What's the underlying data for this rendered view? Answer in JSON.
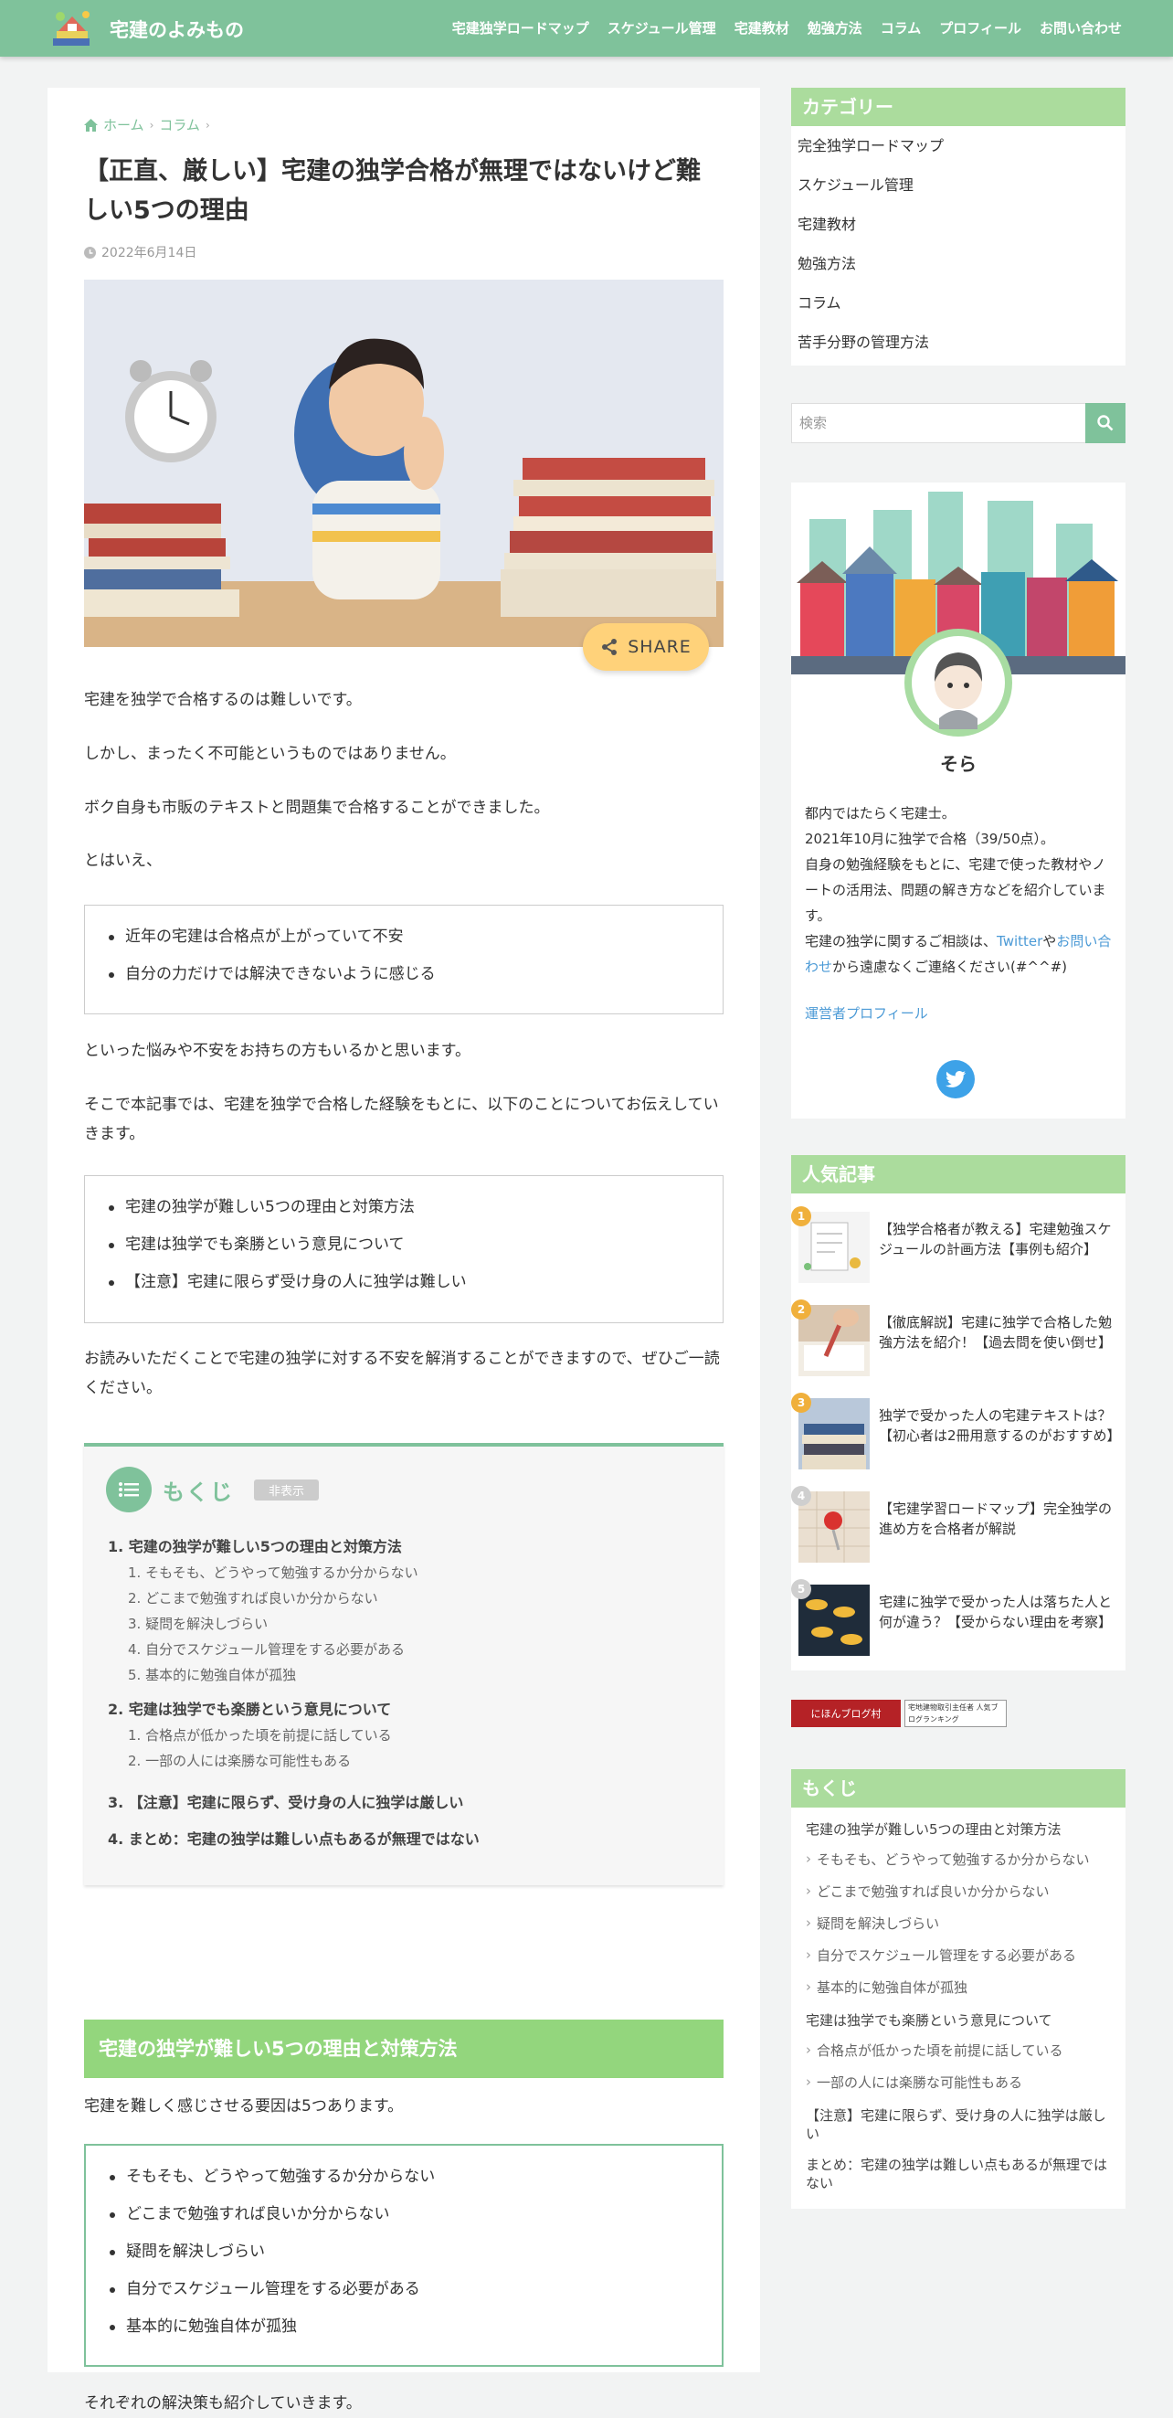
{
  "header": {
    "site_title": "宅建のよみもの",
    "nav": [
      "宅建独学ロードマップ",
      "スケジュール管理",
      "宅建教材",
      "勉強方法",
      "コラム",
      "プロフィール",
      "お問い合わせ"
    ]
  },
  "breadcrumb": {
    "home": "ホーム",
    "category": "コラム"
  },
  "article": {
    "title": "【正直、厳しい】宅建の独学合格が無理ではないけど難しい5つの理由",
    "date": "2022年6月14日",
    "share": "SHARE",
    "p1": "宅建を独学で合格するのは難しいです。",
    "p2": "しかし、まったく不可能というものではありません。",
    "p3": "ボク自身も市販のテキストと問題集で合格することができました。",
    "p4": "とはいえ、",
    "box1": [
      "近年の宅建は合格点が上がっていて不安",
      "自分の力だけでは解決できないように感じる"
    ],
    "p5": "といった悩みや不安をお持ちの方もいるかと思います。",
    "p6": "そこで本記事では、宅建を独学で合格した経験をもとに、以下のことについてお伝えしていきます。",
    "box2": [
      "宅建の独学が難しい5つの理由と対策方法",
      "宅建は独学でも楽勝という意見について",
      "【注意】宅建に限らず受け身の人に独学は難しい"
    ],
    "p7": "お読みいただくことで宅建の独学に対する不安を解消することができますので、ぜひご一読ください。",
    "h2": "宅建の独学が難しい5つの理由と対策方法",
    "p8": "宅建を難しく感じさせる要因は5つあります。",
    "box3": [
      "そもそも、どうやって勉強するか分からない",
      "どこまで勉強すれば良いか分からない",
      "疑問を解決しづらい",
      "自分でスケジュール管理をする必要がある",
      "基本的に勉強自体が孤独"
    ],
    "p9": "それぞれの解決策も紹介していきます。"
  },
  "toc": {
    "title": "もくじ",
    "toggle": "非表示",
    "s1": "1. 宅建の独学が難しい5つの理由と対策方法",
    "s1_items": [
      "1. そもそも、どうやって勉強するか分からない",
      "2. どこまで勉強すれば良いか分からない",
      "3. 疑問を解決しづらい",
      "4. 自分でスケジュール管理をする必要がある",
      "5. 基本的に勉強自体が孤独"
    ],
    "s2": "2. 宅建は独学でも楽勝という意見について",
    "s2_items": [
      "1. 合格点が低かった頃を前提に話している",
      "2. 一部の人には楽勝な可能性もある"
    ],
    "s3": "3. 【注意】宅建に限らず、受け身の人に独学は厳しい",
    "s4": "4. まとめ：宅建の独学は難しい点もあるが無理ではない"
  },
  "sidebar": {
    "category_title": "カテゴリー",
    "categories": [
      "完全独学ロードマップ",
      "スケジュール管理",
      "宅建教材",
      "勉強方法",
      "コラム",
      "苦手分野の管理方法"
    ],
    "search_placeholder": "検索",
    "profile": {
      "name": "そら",
      "l1": "都内ではたらく宅建士。",
      "l2": "2021年10月に独学で合格（39/50点）。",
      "l3": "自身の勉強経験をもとに、宅建で使った教材やノートの活用法、問題の解き方などを紹介しています。",
      "l4a": "宅建の独学に関するご相談は、",
      "l4_twitter": "Twitter",
      "l4b": "や",
      "l4_contact": "お問い合わせ",
      "l4c": "から遠慮なくご連絡ください(#^^#)",
      "link": "運営者プロフィール"
    },
    "popular_title": "人気記事",
    "popular": [
      {
        "rank": "1",
        "title": "【独学合格者が教える】宅建勉強スケジュールの計画方法【事例も紹介】"
      },
      {
        "rank": "2",
        "title": "【徹底解説】宅建に独学で合格した勉強方法を紹介！【過去問を使い倒せ】"
      },
      {
        "rank": "3",
        "title": "独学で受かった人の宅建テキストは？【初心者は2冊用意するのがおすすめ】"
      },
      {
        "rank": "4",
        "title": "【宅建学習ロードマップ】完全独学の進め方を合格者が解説"
      },
      {
        "rank": "5",
        "title": "宅建に独学で受かった人は落ちた人と何が違う？【受からない理由を考察】"
      }
    ],
    "rank_colors": [
      "#f0b03c",
      "#f0b03c",
      "#f0b03c",
      "#cfcfcf",
      "#cfcfcf"
    ],
    "banner1": "にほんブログ村",
    "banner2": "宅地建物取引主任者 人気ブログランキング",
    "toc_title": "もくじ",
    "toc": [
      {
        "t": "宅建の独学が難しい5つの理由と対策方法",
        "lvl": 1
      },
      {
        "t": "そもそも、どうやって勉強するか分からない",
        "lvl": 2
      },
      {
        "t": "どこまで勉強すれば良いか分からない",
        "lvl": 2
      },
      {
        "t": "疑問を解決しづらい",
        "lvl": 2
      },
      {
        "t": "自分でスケジュール管理をする必要がある",
        "lvl": 2
      },
      {
        "t": "基本的に勉強自体が孤独",
        "lvl": 2
      },
      {
        "t": "宅建は独学でも楽勝という意見について",
        "lvl": 1
      },
      {
        "t": "合格点が低かった頃を前提に話している",
        "lvl": 2
      },
      {
        "t": "一部の人には楽勝な可能性もある",
        "lvl": 2
      },
      {
        "t": "【注意】宅建に限らず、受け身の人に独学は厳しい",
        "lvl": 1
      },
      {
        "t": "まとめ：宅建の独学は難しい点もあるが無理ではない",
        "lvl": 1
      }
    ]
  },
  "colors": {
    "brand": "#7fc29b",
    "heading": "#93d67d",
    "widget_head": "#abdc9d",
    "share": "#ffd27a",
    "link": "#4b9ad6"
  }
}
